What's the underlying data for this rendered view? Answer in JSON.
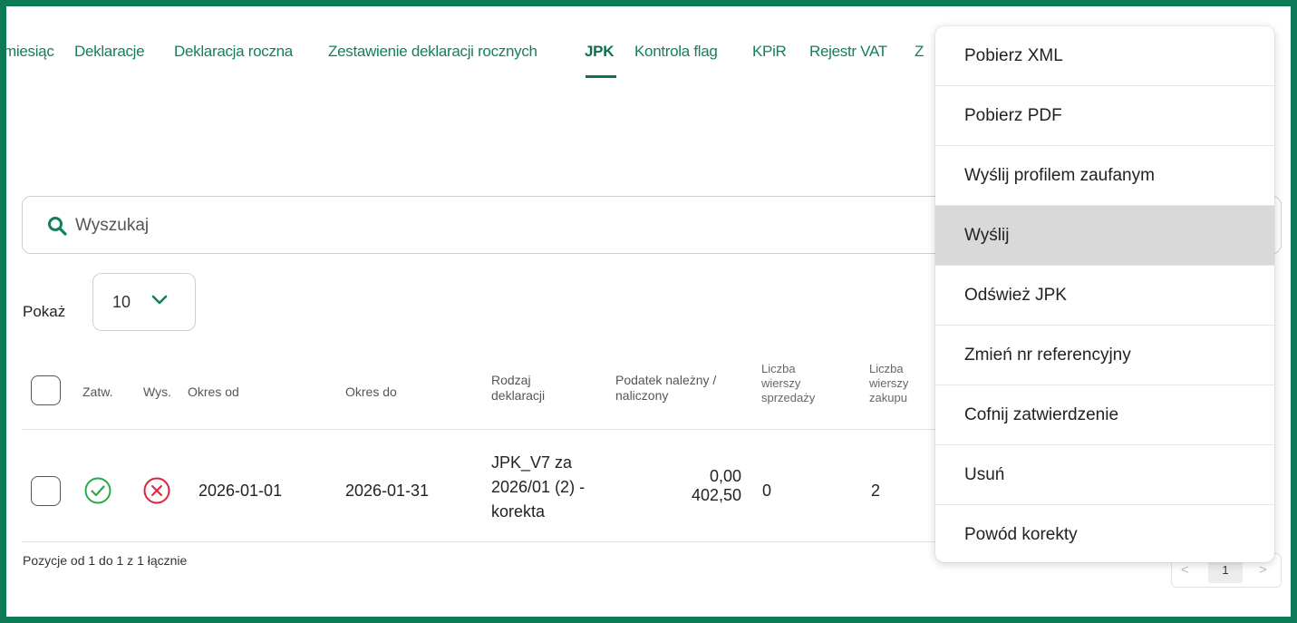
{
  "tabs": [
    {
      "label": "miesiąc",
      "active": false
    },
    {
      "label": "Deklaracje",
      "active": false
    },
    {
      "label": "Deklaracja roczna",
      "active": false
    },
    {
      "label": "Zestawienie deklaracji rocznych",
      "active": false
    },
    {
      "label": "JPK",
      "active": true
    },
    {
      "label": "Kontrola flag",
      "active": false
    },
    {
      "label": "KPiR",
      "active": false
    },
    {
      "label": "Rejestr VAT",
      "active": false
    },
    {
      "label": "Z",
      "active": false
    }
  ],
  "search": {
    "placeholder": "Wyszukaj"
  },
  "show": {
    "label": "Pokaż",
    "value": "10"
  },
  "table": {
    "headers": {
      "approved": "Zatw.",
      "sent": "Wys.",
      "period_from": "Okres od",
      "period_to": "Okres do",
      "declaration_type": [
        "Rodzaj",
        "deklaracji"
      ],
      "tax": [
        "Podatek należny /",
        "naliczony"
      ],
      "sales_rows": [
        "Liczba",
        "wierszy",
        "sprzedaży"
      ],
      "purchase_rows": [
        "Liczba",
        "wierszy",
        "zakupu"
      ]
    },
    "rows": [
      {
        "approved": true,
        "sent": false,
        "period_from": "2026-01-01",
        "period_to": "2026-01-31",
        "declaration_type": [
          "JPK_V7 za",
          "2026/01 (2) -",
          "korekta"
        ],
        "tax_due": "0,00",
        "tax_input": "402,50",
        "sales_rows": "0",
        "purchase_rows": "2"
      }
    ]
  },
  "footer": {
    "summary": "Pozycje od 1 do 1 z 1 łącznie"
  },
  "pagination": {
    "prev": "<",
    "current": "1",
    "next": ">"
  },
  "menu": {
    "items": [
      {
        "label": "Pobierz XML",
        "highlighted": false
      },
      {
        "label": "Pobierz PDF",
        "highlighted": false
      },
      {
        "label": "Wyślij profilem zaufanym",
        "highlighted": false
      },
      {
        "label": "Wyślij",
        "highlighted": true
      },
      {
        "label": "Odśwież JPK",
        "highlighted": false
      },
      {
        "label": "Zmień nr referencyjny",
        "highlighted": false
      },
      {
        "label": "Cofnij zatwierdzenie",
        "highlighted": false
      },
      {
        "label": "Usuń",
        "highlighted": false
      },
      {
        "label": "Powód korekty",
        "highlighted": false
      }
    ]
  },
  "colors": {
    "frame": "#0f7a58",
    "accent": "#12805f",
    "approved": "#2aa84a",
    "not_sent": "#e0233a",
    "highlight": "#d9d9d9"
  },
  "icons": {
    "search": "search-icon",
    "chevron": "chevron-down-icon",
    "approved": "check-circle-icon",
    "not_sent": "x-circle-icon"
  }
}
